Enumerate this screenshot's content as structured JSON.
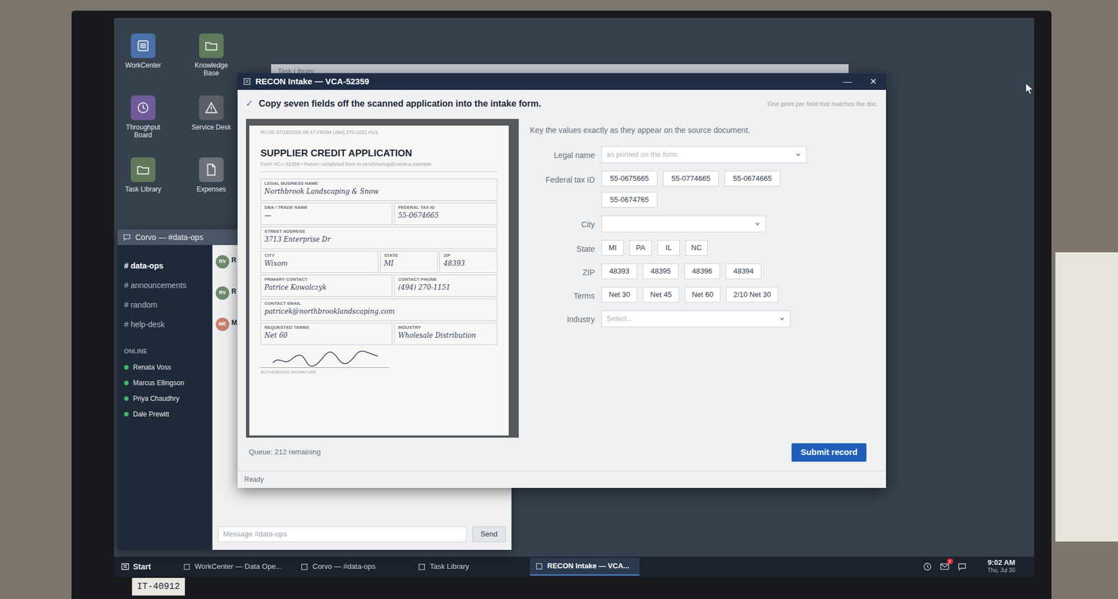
{
  "desktop_icons": [
    {
      "label": "WorkCenter",
      "color": "#4b6fa8"
    },
    {
      "label": "Knowledge Base",
      "color": "#5f7a5a"
    },
    {
      "label": "Throughput Board",
      "color": "#6f5a9a"
    },
    {
      "label": "Service Desk",
      "color": "#5a5f66"
    },
    {
      "label": "Task Library",
      "color": "#5f7a5a"
    },
    {
      "label": "Expenses",
      "color": "#6b7079"
    }
  ],
  "task_library_window": {
    "title": "Task Library"
  },
  "corvo": {
    "title": "Corvo — #data-ops",
    "channels": [
      {
        "label": "# data-ops",
        "selected": true
      },
      {
        "label": "# announcements",
        "selected": false
      },
      {
        "label": "# random",
        "selected": false
      },
      {
        "label": "# help-desk",
        "selected": false
      }
    ],
    "online_heading": "ONLINE",
    "online": [
      "Renata Voss",
      "Marcus Ellingson",
      "Priya Chaudhry",
      "Dale Prewitt"
    ],
    "messages": [
      {
        "avatar": "RV",
        "author": "R",
        "color": "#6f8a6a"
      },
      {
        "avatar": "RV",
        "author": "R",
        "color": "#6f8a6a"
      },
      {
        "avatar": "ME",
        "author": "M",
        "color": "#c7806f"
      }
    ],
    "composer": {
      "placeholder": "Message #data-ops",
      "send": "Send"
    }
  },
  "recon": {
    "title": "RECON Intake — VCA-52359",
    "controls": [
      "—",
      "✕"
    ],
    "instruction": {
      "check": "✓",
      "text": "Copy seven fields off the scanned application into the intake form.",
      "hint": "One point per field that matches the doc."
    },
    "document": {
      "header": "RCVD 07/18/2026 08:47 FROM (494) 270-1151 #1/1",
      "title": "SUPPLIER CREDIT APPLICATION",
      "subtitle": "Form VCA-52359 • Return completed form to vendorsetup@vantica.example",
      "rows": [
        [
          {
            "label": "LEGAL BUSINESS NAME",
            "value": "Northbrook Landscaping & Snow"
          }
        ],
        [
          {
            "label": "DBA / TRADE NAME",
            "value": "—"
          },
          {
            "label": "FEDERAL TAX ID",
            "value": "55-0674665"
          }
        ],
        [
          {
            "label": "STREET ADDRESS",
            "value": "3713 Enterprise Dr"
          }
        ],
        [
          {
            "label": "CITY",
            "value": "Wixom"
          },
          {
            "label": "STATE",
            "value": "MI"
          },
          {
            "label": "ZIP",
            "value": "48393"
          }
        ],
        [
          {
            "label": "PRIMARY CONTACT",
            "value": "Patrice Kowalczyk"
          },
          {
            "label": "CONTACT PHONE",
            "value": "(494) 270-1151"
          }
        ],
        [
          {
            "label": "CONTACT EMAIL",
            "value": "patricek@northbrooklandscaping.com"
          }
        ],
        [
          {
            "label": "REQUESTED TERMS",
            "value": "Net 60"
          },
          {
            "label": "INDUSTRY",
            "value": "Wholesale Distribution"
          }
        ]
      ],
      "signature_label": "AUTHORIZED SIGNATURE"
    },
    "form": {
      "intro": "Key the values exactly as they appear on the source document.",
      "fields": [
        {
          "label": "Legal name",
          "kind": "dropdown",
          "placeholder": "as printed on the form"
        },
        {
          "label": "Federal tax ID",
          "kind": "choices",
          "options": [
            {
              "label": "55-0675665",
              "selected": false
            },
            {
              "label": "55-0774665",
              "selected": false
            },
            {
              "label": "55-0674665",
              "selected": false
            },
            {
              "label": "55-0674765",
              "selected": false
            }
          ]
        },
        {
          "label": "City",
          "kind": "dropdown",
          "placeholder": ""
        },
        {
          "label": "State",
          "kind": "choices",
          "options": [
            {
              "label": "MI",
              "selected": false
            },
            {
              "label": "PA",
              "selected": false
            },
            {
              "label": "IL",
              "selected": false
            },
            {
              "label": "NC",
              "selected": false
            }
          ]
        },
        {
          "label": "ZIP",
          "kind": "choices",
          "options": [
            {
              "label": "48393",
              "selected": false
            },
            {
              "label": "48395",
              "selected": false
            },
            {
              "label": "48396",
              "selected": false
            },
            {
              "label": "48394",
              "selected": false
            }
          ]
        },
        {
          "label": "Terms",
          "kind": "choices",
          "options": [
            {
              "label": "Net 30",
              "selected": false
            },
            {
              "label": "Net 45",
              "selected": false
            },
            {
              "label": "Net 60",
              "selected": false
            },
            {
              "label": "2/10 Net 30",
              "selected": false
            }
          ]
        },
        {
          "label": "Industry",
          "kind": "dropdown",
          "placeholder": "Select..."
        }
      ]
    },
    "queue": "Queue: 212 remaining",
    "submit": "Submit record",
    "status": "Ready"
  },
  "taskbar": {
    "start": "Start",
    "items": [
      {
        "label": "WorkCenter — Data Ope...",
        "selected": false
      },
      {
        "label": "Corvo — #data-ops",
        "selected": false
      },
      {
        "label": "Task Library",
        "selected": false
      },
      {
        "label": "RECON Intake — VCA...",
        "selected": true
      }
    ],
    "mail_badge": "3",
    "time": "9:02 AM",
    "date": "Thu, Jul 30"
  },
  "sticker": "IT-40912"
}
